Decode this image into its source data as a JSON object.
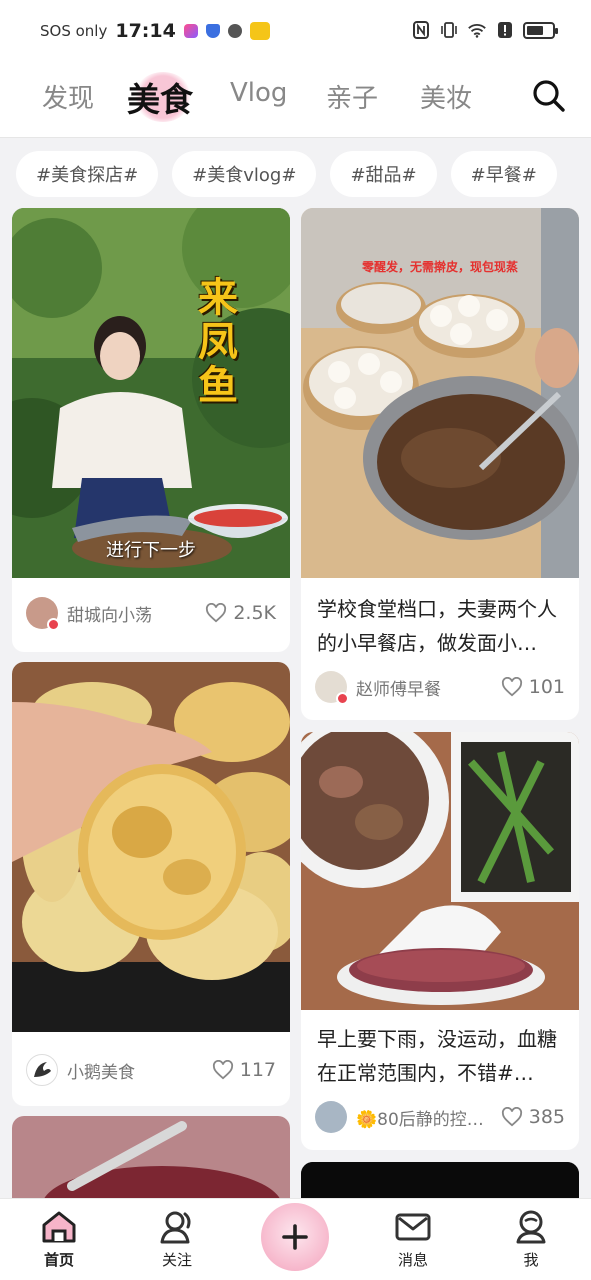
{
  "status_bar": {
    "sos": "SOS only",
    "time": "17:14"
  },
  "top_tabs": [
    "发现",
    "美食",
    "Vlog",
    "亲子",
    "美妆"
  ],
  "active_tab": "美食",
  "tags": [
    "#美食探店#",
    "#美食vlog#",
    "#甜品#",
    "#早餐#"
  ],
  "cards": {
    "c1": {
      "overlay_title": "来凤鱼",
      "subtitle": "进行下一步",
      "author": "甜城向小荡",
      "likes": "2.5K"
    },
    "c2": {
      "caption": "零醒发，无需擀皮，现包现蒸",
      "title": "学校食堂档口，夫妻两个人的小早餐店，做发面小…",
      "author": "赵师傅早餐",
      "likes": "101"
    },
    "c3": {
      "author": "小鹅美食",
      "likes": "117"
    },
    "c4": {
      "title": "早上要下雨，没运动，血糖在正常范围内，不错#…",
      "author": "🌼80后静的控…",
      "likes": "385"
    }
  },
  "bottom_nav": {
    "home": "首页",
    "follow": "关注",
    "messages": "消息",
    "me": "我"
  },
  "colors": {
    "accent_pink": "#f6b4c9",
    "verified_red": "#e8434f"
  }
}
